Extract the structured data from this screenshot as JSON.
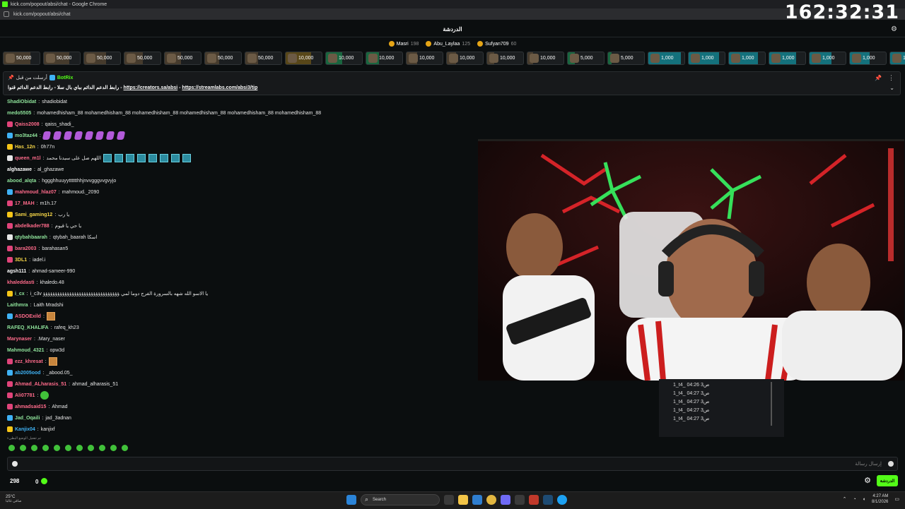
{
  "window": {
    "title": "kick.com/popout/absi/chat - Google Chrome",
    "url": "kick.com/popout/absi/chat"
  },
  "timer": "162:32:31",
  "chat_header": {
    "title": "الدردشة"
  },
  "leaderboard": [
    {
      "name": "Masri",
      "points": "198"
    },
    {
      "name": "Abu_Laylaa",
      "points": "125"
    },
    {
      "name": "Sufyan709",
      "points": "60"
    }
  ],
  "gifts": [
    {
      "amount": "50,000",
      "fill": 0.75,
      "tier": 1
    },
    {
      "amount": "50,000",
      "fill": 0.7,
      "tier": 1
    },
    {
      "amount": "50,000",
      "fill": 0.6,
      "tier": 1
    },
    {
      "amount": "50,000",
      "fill": 0.5,
      "tier": 1
    },
    {
      "amount": "50,000",
      "fill": 0.45,
      "tier": 1
    },
    {
      "amount": "50,000",
      "fill": 0.4,
      "tier": 1
    },
    {
      "amount": "50,000",
      "fill": 0.35,
      "tier": 1
    },
    {
      "amount": "10,000",
      "fill": 0.7,
      "tier": 2
    },
    {
      "amount": "10,000",
      "fill": 0.45,
      "tier": 3
    },
    {
      "amount": "10,000",
      "fill": 0.35,
      "tier": 3
    },
    {
      "amount": "10,000",
      "fill": 0.3,
      "tier": 1
    },
    {
      "amount": "10,000",
      "fill": 0.25,
      "tier": 1
    },
    {
      "amount": "10,000",
      "fill": 0.2,
      "tier": 1
    },
    {
      "amount": "10,000",
      "fill": 0.15,
      "tier": 1
    },
    {
      "amount": "5,000",
      "fill": 0.2,
      "tier": 3
    },
    {
      "amount": "5,000",
      "fill": 0.1,
      "tier": 3
    },
    {
      "amount": "1,000",
      "fill": 0.9,
      "tier": 4
    },
    {
      "amount": "1,000",
      "fill": 0.85,
      "tier": 4
    },
    {
      "amount": "1,000",
      "fill": 0.8,
      "tier": 4
    },
    {
      "amount": "1,000",
      "fill": 0.75,
      "tier": 4
    },
    {
      "amount": "1,000",
      "fill": 0.6,
      "tier": 4
    },
    {
      "amount": "1,000",
      "fill": 0.55,
      "tier": 4
    },
    {
      "amount": "1,000",
      "fill": 0.5,
      "tier": 4
    }
  ],
  "pinned": {
    "pinned_by": "أرسلت من قبل",
    "bot": "BotRix",
    "text_prefix": "رابط الدعم الدائم بباي بال سلا - رابط الدعم الدائم قنوا - ",
    "link1": "https://creators.sa/absi",
    "sep": " - ",
    "link2": "https://streamlabs.com/absi3/tip"
  },
  "messages": [
    {
      "user": "ShadiObidat",
      "color": "#8fe39b",
      "text": "shadiobidat"
    },
    {
      "user": "medo5505",
      "color": "#8fe39b",
      "text": "mohamedhisham_88 mohamedhisham_88 mohamedhisham_88 mohamedhisham_88 mohamedhisham_88 mohamedhisham_88"
    },
    {
      "user": "Qaiss2008",
      "color": "#ff6b8b",
      "text": "qaiss_shadi_",
      "badge": "#e0447a"
    },
    {
      "user": "mo3taz44",
      "color": "#8fe39b",
      "text": "",
      "badge": "#3fb2f5",
      "emotes": 8
    },
    {
      "user": "Has_12n",
      "color": "#f5d547",
      "text": "0h77n",
      "badge": "#f5c518"
    },
    {
      "user": "queen_m1l",
      "color": "#ff6b8b",
      "text": "اللهم صل على سيدنا محمد",
      "badge": "#e6e6e6",
      "emotes2": 8
    },
    {
      "user": "alghazawe",
      "color": "#ffffff",
      "text": "al_ghazawe"
    },
    {
      "user": "abood_alqta",
      "color": "#8fe39b",
      "text": "hggghhuuyytttttthhjnvvgggvvgvyjo"
    },
    {
      "user": "mahmoud_hlaz07",
      "color": "#ff6b8b",
      "text": "mahmoud._2090",
      "badge": "#3fb2f5"
    },
    {
      "user": "17_MAH",
      "color": "#ff6b8b",
      "text": "m1h.17",
      "badge": "#e0447a"
    },
    {
      "user": "Sami_gaming12",
      "color": "#f5d547",
      "text": "يا رب",
      "badge": "#f5c518"
    },
    {
      "user": "abdelkader788",
      "color": "#ff6b8b",
      "text": "يا حي يا قيوم",
      "badge": "#e0447a"
    },
    {
      "user": "qtybahbaarah",
      "color": "#8fe39b",
      "text": "qtybah_baarah اسكا",
      "badge": "#e6e6e6"
    },
    {
      "user": "bara2003",
      "color": "#ff6b8b",
      "text": "barahasan5",
      "badge": "#e0447a"
    },
    {
      "user": "3DL1",
      "color": "#f5d547",
      "text": "iadel.i",
      "badge": "#e0447a"
    },
    {
      "user": "agsh111",
      "color": "#ffffff",
      "text": "ahmad-sameer-990"
    },
    {
      "user": "khaleddasti",
      "color": "#ff6b8b",
      "text": "khaledo.48"
    },
    {
      "user": "i_cx",
      "color": "#8fe39b",
      "text": "i_c3v يا الاسو الله شهه بالسرورة الفرج دوما لمي ؤؤؤؤؤؤؤؤؤؤؤؤؤؤؤؤؤؤؤؤؤؤؤؤؤؤؤؤؤؤؤؤ",
      "badge": "#f5c518"
    },
    {
      "user": "Laithmra",
      "color": "#8fe39b",
      "text": "Laith Mradshi"
    },
    {
      "user": "ASDOExild",
      "color": "#ff6b8b",
      "text": "",
      "badge": "#3fb2f5",
      "img": true
    },
    {
      "user": "RAFEQ_KHALIFA",
      "color": "#8fe39b",
      "text": "rafeq_kh23"
    },
    {
      "user": "Marynaser",
      "color": "#ff6b8b",
      "text": ".Mary_naser"
    },
    {
      "user": "Mahmoud_4321",
      "color": "#8fe39b",
      "text": "opw3d"
    },
    {
      "user": "ezz_khresat",
      "color": "#ff6b8b",
      "text": "",
      "badge": "#e0447a",
      "img": true
    },
    {
      "user": "ab2005ood",
      "color": "#3fb2f5",
      "text": "_abood.05_",
      "badge": "#3fb2f5"
    },
    {
      "user": "Ahmad_ALharasis_51",
      "color": "#ff6b8b",
      "text": "ahmad_alharasis_51",
      "badge": "#e0447a"
    },
    {
      "user": "Ali07781",
      "color": "#ff6b8b",
      "text": "",
      "badge": "#e0447a",
      "gem": true
    },
    {
      "user": "ahmadsaid15",
      "color": "#ff6b8b",
      "text": "Ahmad",
      "badge": "#e0447a"
    },
    {
      "user": "Jad_Oqaili",
      "color": "#8fe39b",
      "text": "jad_3adnan",
      "badge": "#3fb2f5"
    },
    {
      "user": "Kanjix04",
      "color": "#3fb2f5",
      "text": "kanjixf",
      "badge": "#f5c518"
    }
  ],
  "note": "تم تفعيل الوضع البطيء",
  "overlay": {
    "lines": [
      "1_t4_ ص3 04:26",
      "1_t4_ ص3 04:27",
      "1_t4_ ص3 04:27",
      "1_t4_ ص3 04:27",
      "1_t4_ ص3 04:27"
    ]
  },
  "input": {
    "placeholder": "إرسال رسالة"
  },
  "bottom": {
    "viewers": "298",
    "points": "0",
    "send_label": "الدردشة"
  },
  "taskbar": {
    "weather_temp": "25°C",
    "weather_desc": "صافي غالبا",
    "search_label": "Search",
    "time": "4:27 AM",
    "date": "8/1/2026"
  }
}
